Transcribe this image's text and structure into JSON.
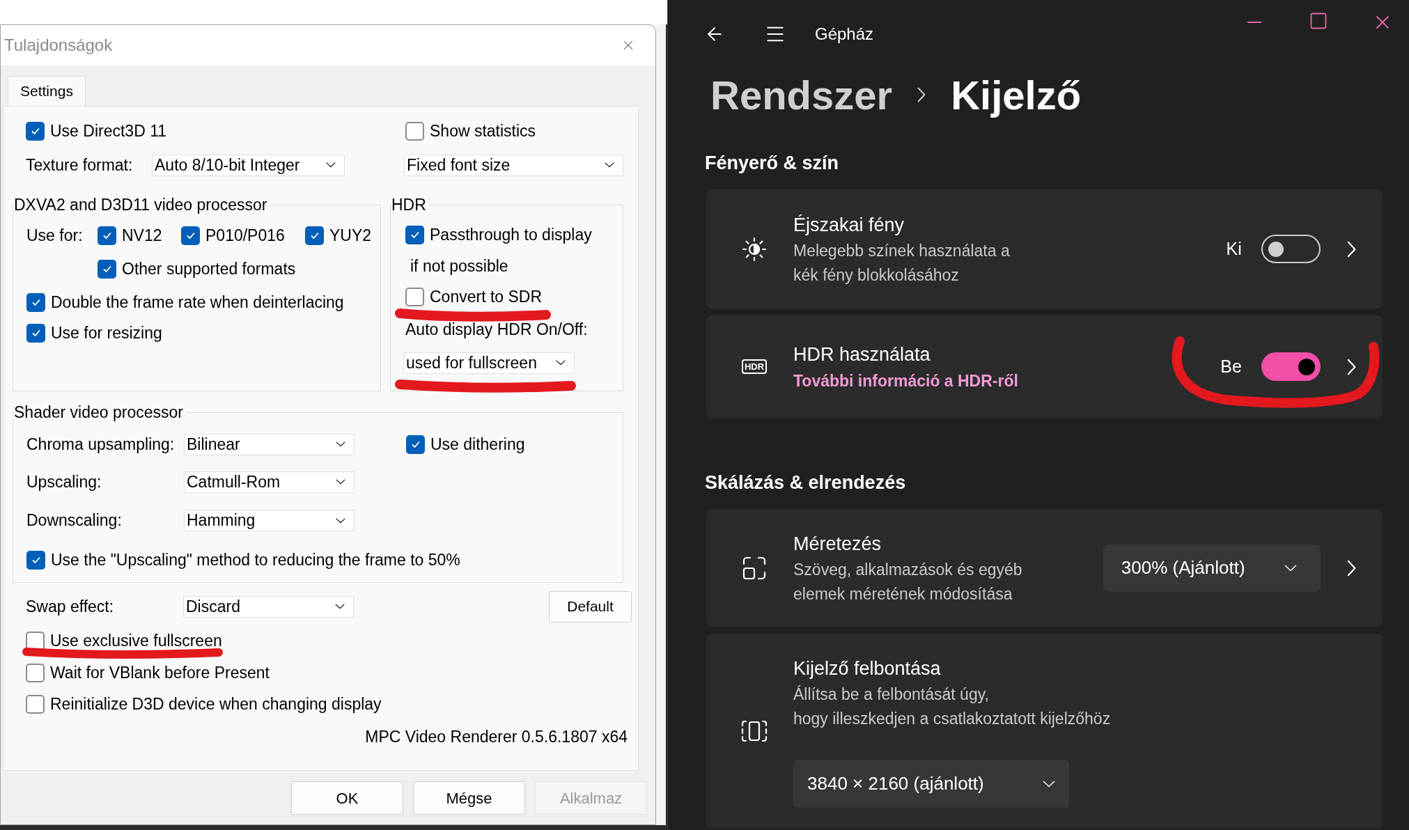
{
  "dialog": {
    "title": "Tulajdonságok",
    "tabs": [
      {
        "label": "Settings",
        "selected": true
      }
    ],
    "use_direct3d": {
      "label": "Use Direct3D 11",
      "checked": true
    },
    "show_statistics": {
      "label": "Show statistics",
      "checked": false
    },
    "texture_format": {
      "label": "Texture format:",
      "value": "Auto 8/10-bit Integer"
    },
    "statistics_font": {
      "value": "Fixed font size"
    },
    "dxva_group": {
      "title": "DXVA2 and D3D11 video processor",
      "use_for_label": "Use for:",
      "formats": [
        {
          "label": "NV12",
          "checked": true
        },
        {
          "label": "P010/P016",
          "checked": true
        },
        {
          "label": "YUY2",
          "checked": true
        }
      ],
      "other_formats": {
        "label": "Other supported formats",
        "checked": true
      },
      "double_frame_rate": {
        "label": "Double the frame rate when deinterlacing",
        "checked": true
      },
      "use_for_resizing": {
        "label": "Use for resizing",
        "checked": true
      }
    },
    "hdr_group": {
      "title": "HDR",
      "passthrough": {
        "label": "Passthrough to display",
        "checked": true
      },
      "fallback_label": "if not possible",
      "convert_to_sdr": {
        "label": "Convert to SDR",
        "checked": false
      },
      "auto_hdr_label": "Auto display HDR On/Off:",
      "auto_hdr": {
        "value": "used for fullscreen"
      }
    },
    "shader_group": {
      "title": "Shader video processor",
      "selects": [
        {
          "label": "Chroma upsampling:",
          "value": "Bilinear"
        },
        {
          "label": "Upscaling:",
          "value": "Catmull-Rom"
        },
        {
          "label": "Downscaling:",
          "value": "Hamming"
        }
      ],
      "use_dithering": {
        "label": "Use dithering",
        "checked": true
      },
      "upscaling_for_half": {
        "label": "Use the \"Upscaling\" method to reducing the frame to 50%",
        "checked": true
      }
    },
    "swap_effect": {
      "label": "Swap effect:",
      "value": "Discard"
    },
    "default_button": "Default",
    "options": [
      {
        "label": "Use exclusive fullscreen",
        "checked": false
      },
      {
        "label": "Wait for VBlank before Present",
        "checked": false
      },
      {
        "label": "Reinitialize D3D device when changing display",
        "checked": false
      }
    ],
    "version": "MPC Video Renderer 0.5.6.1807 x64",
    "buttons": [
      {
        "label": "OK",
        "disabled": false
      },
      {
        "label": "Mégse",
        "disabled": false
      },
      {
        "label": "Alkalmaz",
        "disabled": true
      }
    ]
  },
  "settings": {
    "app_title": "Gépház",
    "breadcrumb": [
      {
        "label": "Rendszer",
        "current": false
      },
      {
        "label": "Kijelző",
        "current": true
      }
    ],
    "sections": [
      {
        "title": "Fényerő & szín",
        "cards": [
          {
            "kind": "toggle",
            "title": "Éjszakai fény",
            "description": [
              "Melegebb színek használata a",
              "kék fény blokkolásához"
            ],
            "state_label": "Ki",
            "on": false
          },
          {
            "kind": "toggle",
            "icon_text": "HDR",
            "title": "HDR használata",
            "link": "További információ a HDR-ről",
            "state_label": "Be",
            "on": true
          }
        ]
      },
      {
        "title": "Skálázás & elrendezés",
        "cards": [
          {
            "kind": "select",
            "title": "Méretezés",
            "description": [
              "Szöveg, alkalmazások és egyéb",
              "elemek méretének módosítása"
            ],
            "value": "300% (Ajánlott)"
          },
          {
            "kind": "select_below",
            "title": "Kijelző felbontása",
            "description": [
              "Állítsa be a felbontását úgy,",
              "hogy illeszkedjen a csatlakoztatott kijelzőhöz"
            ],
            "value": "3840 × 2160 (ajánlott)"
          }
        ]
      }
    ]
  }
}
